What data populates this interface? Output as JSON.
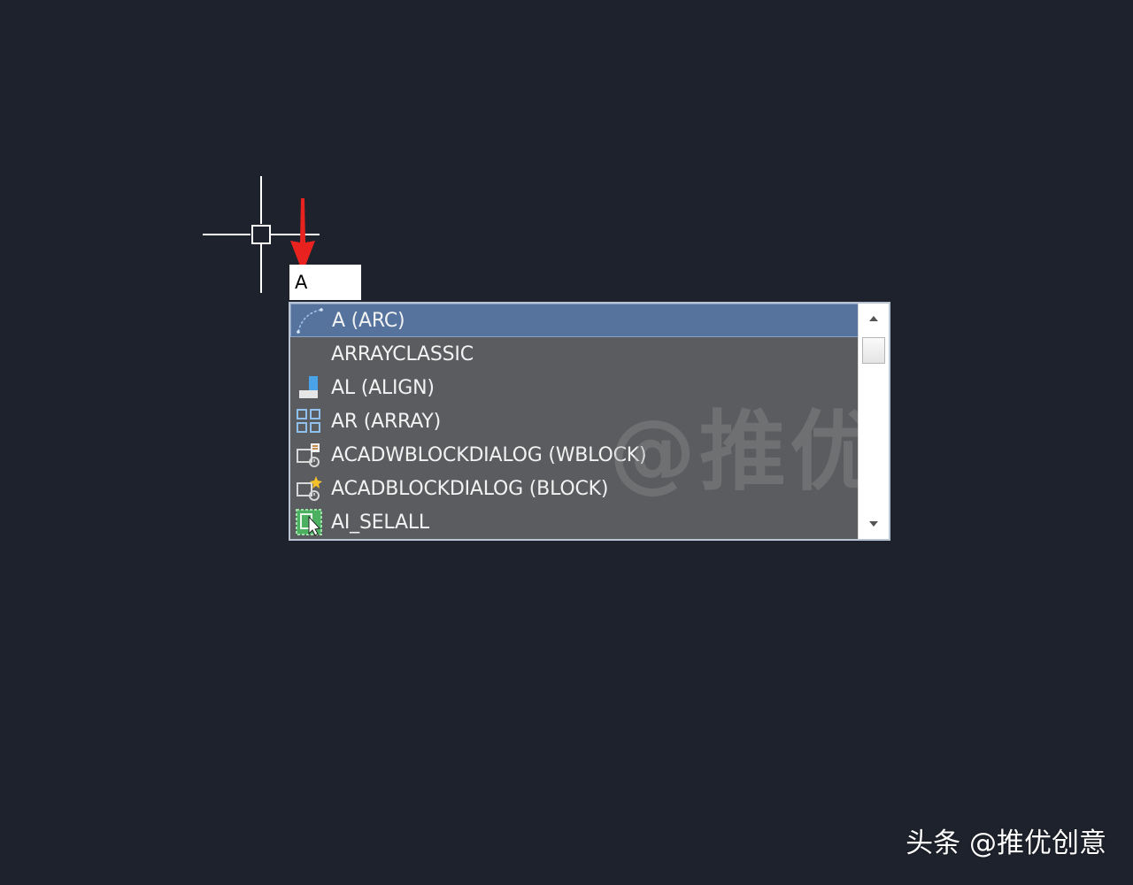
{
  "canvas": {
    "background": "#1e222c"
  },
  "command_input": {
    "value": "A"
  },
  "autocomplete": {
    "selected_index": 0,
    "selected_color": "#56739e",
    "items": [
      {
        "label": "A (ARC)",
        "icon": "arc-icon"
      },
      {
        "label": "ARRAYCLASSIC",
        "icon": ""
      },
      {
        "label": "AL (ALIGN)",
        "icon": "align-icon"
      },
      {
        "label": "AR (ARRAY)",
        "icon": "array-icon"
      },
      {
        "label": "ACADWBLOCKDIALOG (WBLOCK)",
        "icon": "wblock-icon"
      },
      {
        "label": "ACADBLOCKDIALOG (BLOCK)",
        "icon": "block-icon"
      },
      {
        "label": "AI_SELALL",
        "icon": "select-all-icon"
      }
    ],
    "watermark": "@推优创意"
  },
  "annotation": {
    "arrow_color": "#e8231f"
  },
  "source_watermark": "头条 @推优创意"
}
